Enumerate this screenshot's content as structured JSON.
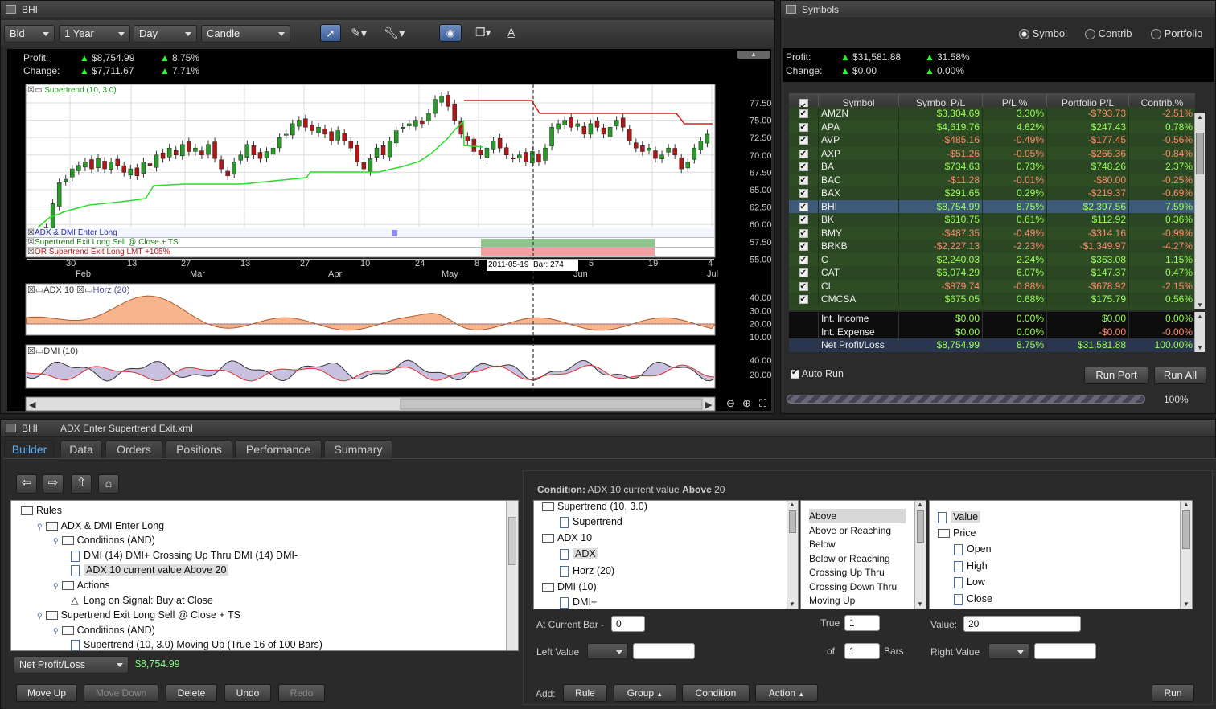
{
  "chart_win": {
    "title": "BHI",
    "dd_bid": "Bid",
    "dd_range": "1 Year",
    "dd_period": "Day",
    "dd_style": "Candle",
    "profit_lbl": "Profit:",
    "profit_val": "$8,754.99",
    "profit_pct": "8.75%",
    "change_lbl": "Change:",
    "change_val": "$7,711.67",
    "change_pct": "7.71%",
    "legend_super": "Supertrend (10, 3.0)",
    "lane1": "ADX & DMI Enter Long",
    "lane2": "Supertrend Exit Long Sell @ Close + TS",
    "lane3": "OR Supertrend Exit Long LMT +105%",
    "adx_lbl": "ADX 10",
    "horz_lbl": "Horz (20)",
    "dmi_lbl": "DMI (10)",
    "cursor_date": "2011-05-19",
    "cursor_bar": "Bar:",
    "cursor_barnum": "274",
    "yticks": [
      "77.50",
      "75.00",
      "72.50",
      "70.00",
      "67.50",
      "65.00",
      "62.50",
      "60.00",
      "57.50",
      "55.00"
    ],
    "adx_ticks": [
      "40.00",
      "30.00",
      "20.00",
      "10.00"
    ],
    "dmi_ticks": [
      "40.00",
      "20.00"
    ],
    "xdays": [
      "30",
      "13",
      "27",
      "13",
      "27",
      "10",
      "24",
      "8",
      "5",
      "19",
      "4"
    ],
    "xmonths": [
      "Feb",
      "Mar",
      "Apr",
      "May",
      "Jun",
      "Jul"
    ]
  },
  "symbols_win": {
    "title": "Symbols",
    "radio_symbol": "Symbol",
    "radio_contrib": "Contrib",
    "radio_portfolio": "Portfolio",
    "profit_lbl": "Profit:",
    "profit_val": "$31,581.88",
    "profit_pct": "31.58%",
    "change_lbl": "Change:",
    "change_val": "$0.00",
    "change_pct": "0.00%",
    "headers": [
      "Symbol",
      "Symbol P/L",
      "P/L %",
      "Portfolio P/L",
      "Contrib.%"
    ],
    "rows": [
      [
        "AMZN",
        "$3,304.69",
        "3.30%",
        "-$793.73",
        "-2.51%"
      ],
      [
        "APA",
        "$4,619.76",
        "4.62%",
        "$247.43",
        "0.78%"
      ],
      [
        "AVP",
        "-$485.16",
        "-0.49%",
        "-$177.45",
        "-0.56%"
      ],
      [
        "AXP",
        "-$51.26",
        "-0.05%",
        "-$266.36",
        "-0.84%"
      ],
      [
        "BA",
        "$734.63",
        "0.73%",
        "$748.26",
        "2.37%"
      ],
      [
        "BAC",
        "-$11.28",
        "-0.01%",
        "-$80.00",
        "-0.25%"
      ],
      [
        "BAX",
        "$291.65",
        "0.29%",
        "-$219.37",
        "-0.69%"
      ],
      [
        "BHI",
        "$8,754.99",
        "8.75%",
        "$2,397.56",
        "7.59%"
      ],
      [
        "BK",
        "$610.75",
        "0.61%",
        "$112.92",
        "0.36%"
      ],
      [
        "BMY",
        "-$487.35",
        "-0.49%",
        "-$314.16",
        "-0.99%"
      ],
      [
        "BRKB",
        "-$2,227.13",
        "-2.23%",
        "-$1,349.97",
        "-4.27%"
      ],
      [
        "C",
        "$2,240.03",
        "2.24%",
        "$363.08",
        "1.15%"
      ],
      [
        "CAT",
        "$6,074.29",
        "6.07%",
        "$147.37",
        "0.47%"
      ],
      [
        "CL",
        "-$879.74",
        "-0.88%",
        "-$678.92",
        "-2.15%"
      ],
      [
        "CMCSA",
        "$675.05",
        "0.68%",
        "$175.79",
        "0.56%"
      ]
    ],
    "summary": [
      [
        "Int. Income",
        "$0.00",
        "0.00%",
        "$0.00",
        "0.00%"
      ],
      [
        "Int. Expense",
        "$0.00",
        "0.00%",
        "-$0.00",
        "-0.00%"
      ],
      [
        "Net Profit/Loss",
        "$8,754.99",
        "8.75%",
        "$31,581.88",
        "100.00%"
      ]
    ],
    "auto_run": "Auto Run",
    "run_port": "Run Port",
    "run_all": "Run All",
    "progress": "100%"
  },
  "builder_win": {
    "title": "BHI",
    "file": "ADX Enter Supertrend Exit.xml",
    "tabs": [
      "Builder",
      "Data",
      "Orders",
      "Positions",
      "Performance",
      "Summary"
    ],
    "tree": [
      "Rules",
      "ADX & DMI Enter Long",
      "Conditions (AND)",
      "DMI (14) DMI+ Crossing Up Thru DMI (14) DMI-",
      "ADX 10 current value Above 20",
      "Actions",
      "Long on Signal: Buy at Close",
      "Supertrend Exit Long Sell @ Close + TS",
      "Conditions (AND)",
      "Supertrend (10, 3.0) Moving Up (True 16 of 100 Bars)"
    ],
    "metric": "Net Profit/Loss",
    "metric_val": "$8,754.99",
    "btn_moveup": "Move Up",
    "btn_movedown": "Move Down",
    "btn_delete": "Delete",
    "btn_undo": "Undo",
    "btn_redo": "Redo",
    "cond_prefix": "Condition:",
    "cond_text1": "ADX 10 current value",
    "cond_bold": "Above",
    "cond_text2": "20",
    "ind_list": [
      "Supertrend (10, 3.0)",
      "Supertrend",
      "ADX 10",
      "ADX",
      "Horz (20)",
      "DMI (10)",
      "DMI+"
    ],
    "ops": [
      "Above",
      "Above or Reaching",
      "Below",
      "Below or Reaching",
      "Crossing Up Thru",
      "Crossing Down Thru",
      "Moving Up"
    ],
    "vals": [
      "Value",
      "Price",
      "Open",
      "High",
      "Low",
      "Close"
    ],
    "at_bar_lbl": "At Current Bar -",
    "at_bar_val": "0",
    "true_lbl": "True",
    "true_val": "1",
    "value_lbl": "Value:",
    "value_val": "20",
    "left_lbl": "Left Value",
    "of_lbl": "of",
    "of_val": "1",
    "bars_lbl": "Bars",
    "right_lbl": "Right Value",
    "add_lbl": "Add:",
    "btn_rule": "Rule",
    "btn_group": "Group",
    "btn_condition": "Condition",
    "btn_action": "Action",
    "btn_run": "Run"
  }
}
